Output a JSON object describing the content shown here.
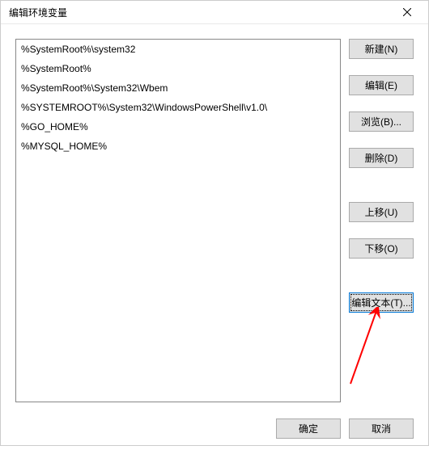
{
  "title": "编辑环境变量",
  "list_items": [
    "%SystemRoot%\\system32",
    "%SystemRoot%",
    "%SystemRoot%\\System32\\Wbem",
    "%SYSTEMROOT%\\System32\\WindowsPowerShell\\v1.0\\",
    "%GO_HOME%",
    "%MYSQL_HOME%"
  ],
  "buttons": {
    "new": "新建(N)",
    "edit": "编辑(E)",
    "browse": "浏览(B)...",
    "delete": "删除(D)",
    "move_up": "上移(U)",
    "move_down": "下移(O)",
    "edit_text": "编辑文本(T)..."
  },
  "footer": {
    "ok": "确定",
    "cancel": "取消"
  },
  "annotation_color": "#ff0000"
}
